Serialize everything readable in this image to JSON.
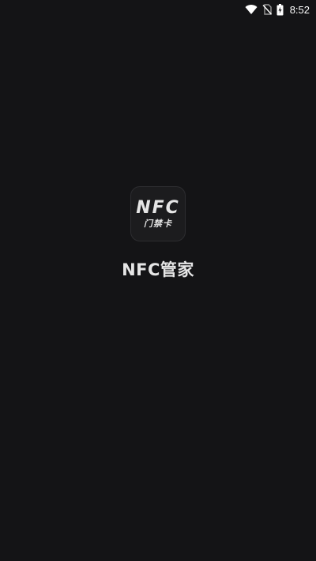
{
  "status_bar": {
    "time": "8:52",
    "icons": [
      "wifi-icon",
      "no-sim-icon",
      "battery-charging-icon"
    ]
  },
  "splash": {
    "logo_text": "NFC",
    "logo_subtext": "门禁卡",
    "app_name": "NFC管家"
  },
  "colors": {
    "background": "#141416",
    "text": "#e6e6e6",
    "icon_tile": "#1c1c1e"
  }
}
